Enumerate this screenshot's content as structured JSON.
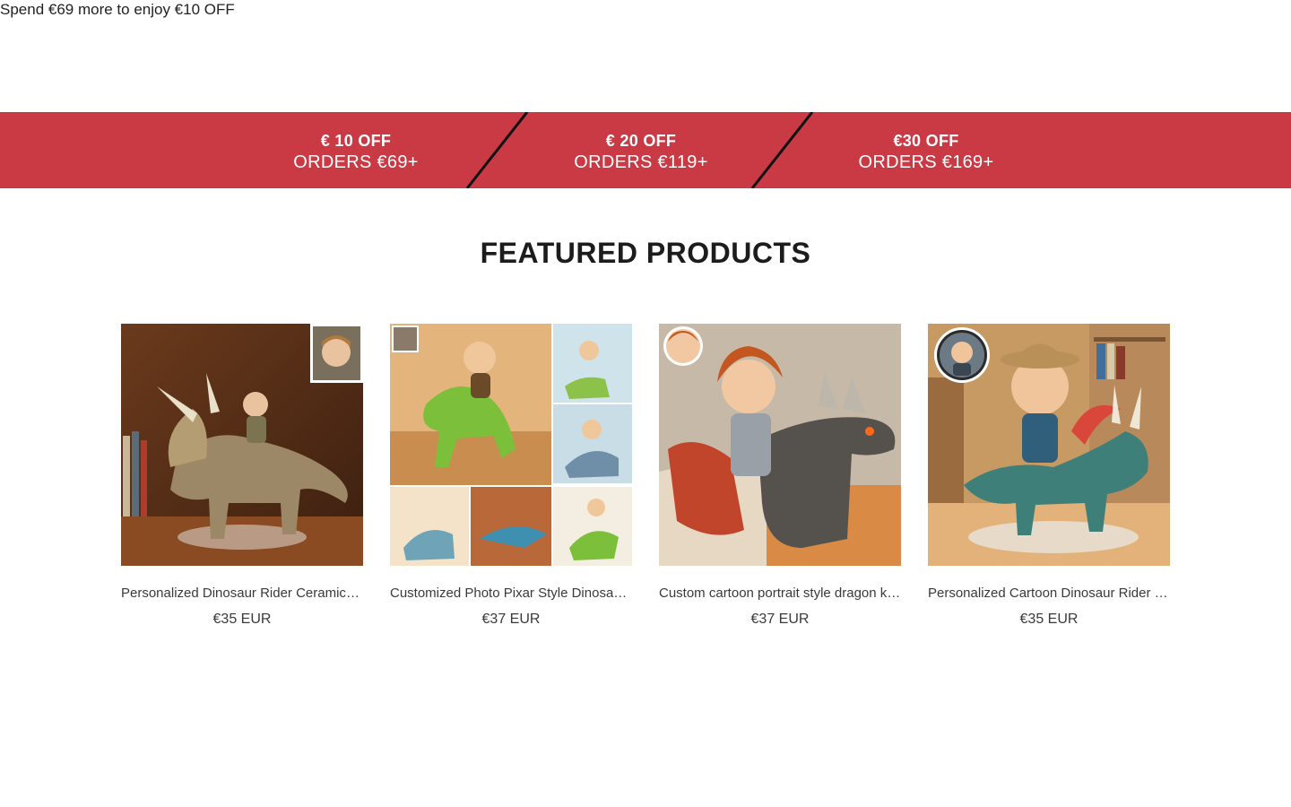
{
  "announcement": {
    "text": "Spend €69 more to enjoy €10 OFF"
  },
  "promo": {
    "background": "#c93a44",
    "tiers": [
      {
        "off": "€ 10 OFF",
        "orders": "ORDERS €69+"
      },
      {
        "off": "€ 20 OFF",
        "orders": "ORDERS €119+"
      },
      {
        "off": "€30 OFF",
        "orders": "ORDERS €169+"
      }
    ]
  },
  "featured": {
    "title": "FEATURED PRODUCTS",
    "products": [
      {
        "title": "Personalized Dinosaur Rider Ceramic Figurine",
        "price": "€35 EUR",
        "image_icon": "triceratops-rider-photo"
      },
      {
        "title": "Customized Photo Pixar Style Dinosaur Rider",
        "price": "€37 EUR",
        "image_icon": "pixar-dinosaur-collage-photo"
      },
      {
        "title": "Custom cartoon portrait style dragon knight",
        "price": "€37 EUR",
        "image_icon": "dragon-knight-photo"
      },
      {
        "title": "Personalized Cartoon Dinosaur Rider Figurine",
        "price": "€35 EUR",
        "image_icon": "cartoon-triceratops-rider-photo"
      }
    ]
  }
}
